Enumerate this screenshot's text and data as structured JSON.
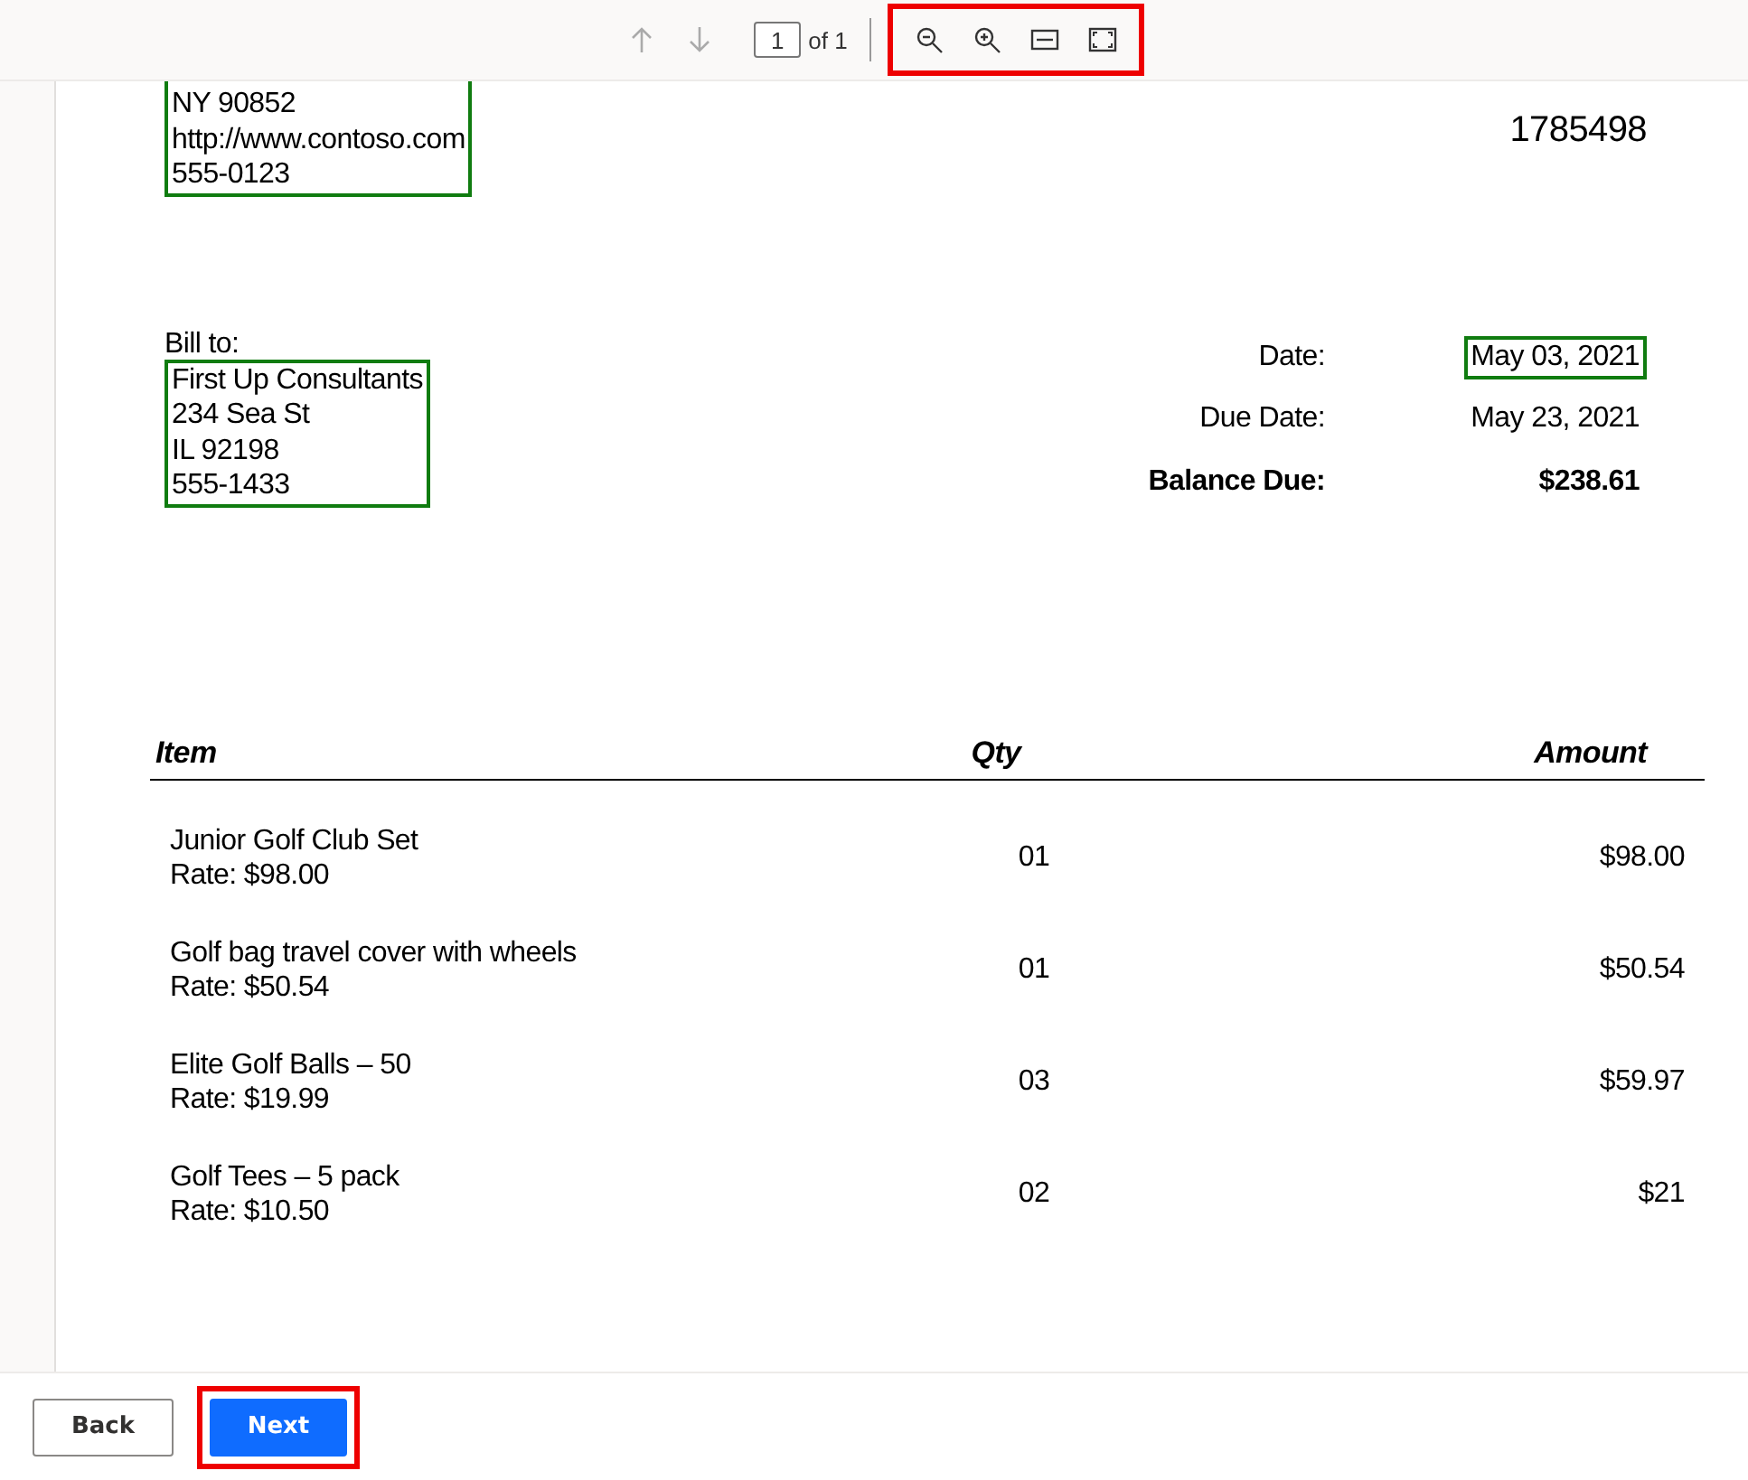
{
  "toolbar": {
    "page_input": "1",
    "page_count": "of 1",
    "highlighted": true,
    "buttons": [
      {
        "kind": "up",
        "disabled": true
      },
      {
        "kind": "down",
        "disabled": true
      },
      {
        "kind": "zoom-out",
        "disabled": false
      },
      {
        "kind": "zoom-in",
        "disabled": false
      },
      {
        "kind": "fit-width",
        "disabled": false
      },
      {
        "kind": "fit-page",
        "disabled": false
      }
    ]
  },
  "document": {
    "sender": {
      "lines": [
        "NY 90852",
        "http://www.contoso.com",
        "555-0123"
      ],
      "outlined": true
    },
    "invoice_number": "1785498",
    "bill_to": {
      "label": "Bill to:",
      "lines": [
        "First Up Consultants",
        "234 Sea St",
        "IL 92198",
        "555-1433"
      ],
      "outlined": true
    },
    "summary": [
      {
        "label": "Date:",
        "value": "May 03, 2021",
        "bold": false,
        "outlined": true
      },
      {
        "label": "Due Date:",
        "value": "May 23, 2021",
        "bold": false,
        "outlined": false
      },
      {
        "label": "Balance Due:",
        "value": "$238.61",
        "bold": true,
        "outlined": false
      }
    ],
    "table": {
      "columns": [
        "Item",
        "Qty",
        "Amount"
      ],
      "rows": [
        {
          "item": "Junior Golf Club Set",
          "rate": "Rate: $98.00",
          "qty": "01",
          "amount": "$98.00"
        },
        {
          "item": "Golf bag travel cover with wheels",
          "rate": "Rate: $50.54",
          "qty": "01",
          "amount": "$50.54"
        },
        {
          "item": "Elite Golf Balls – 50",
          "rate": "Rate: $19.99",
          "qty": "03",
          "amount": "$59.97"
        },
        {
          "item": "Golf Tees – 5 pack",
          "rate": "Rate: $10.50",
          "qty": "02",
          "amount": "$21"
        }
      ]
    }
  },
  "footer": {
    "buttons": [
      {
        "label": "Back",
        "kind": "secondary",
        "highlighted": false
      },
      {
        "label": "Next",
        "kind": "primary",
        "highlighted": true
      }
    ]
  }
}
